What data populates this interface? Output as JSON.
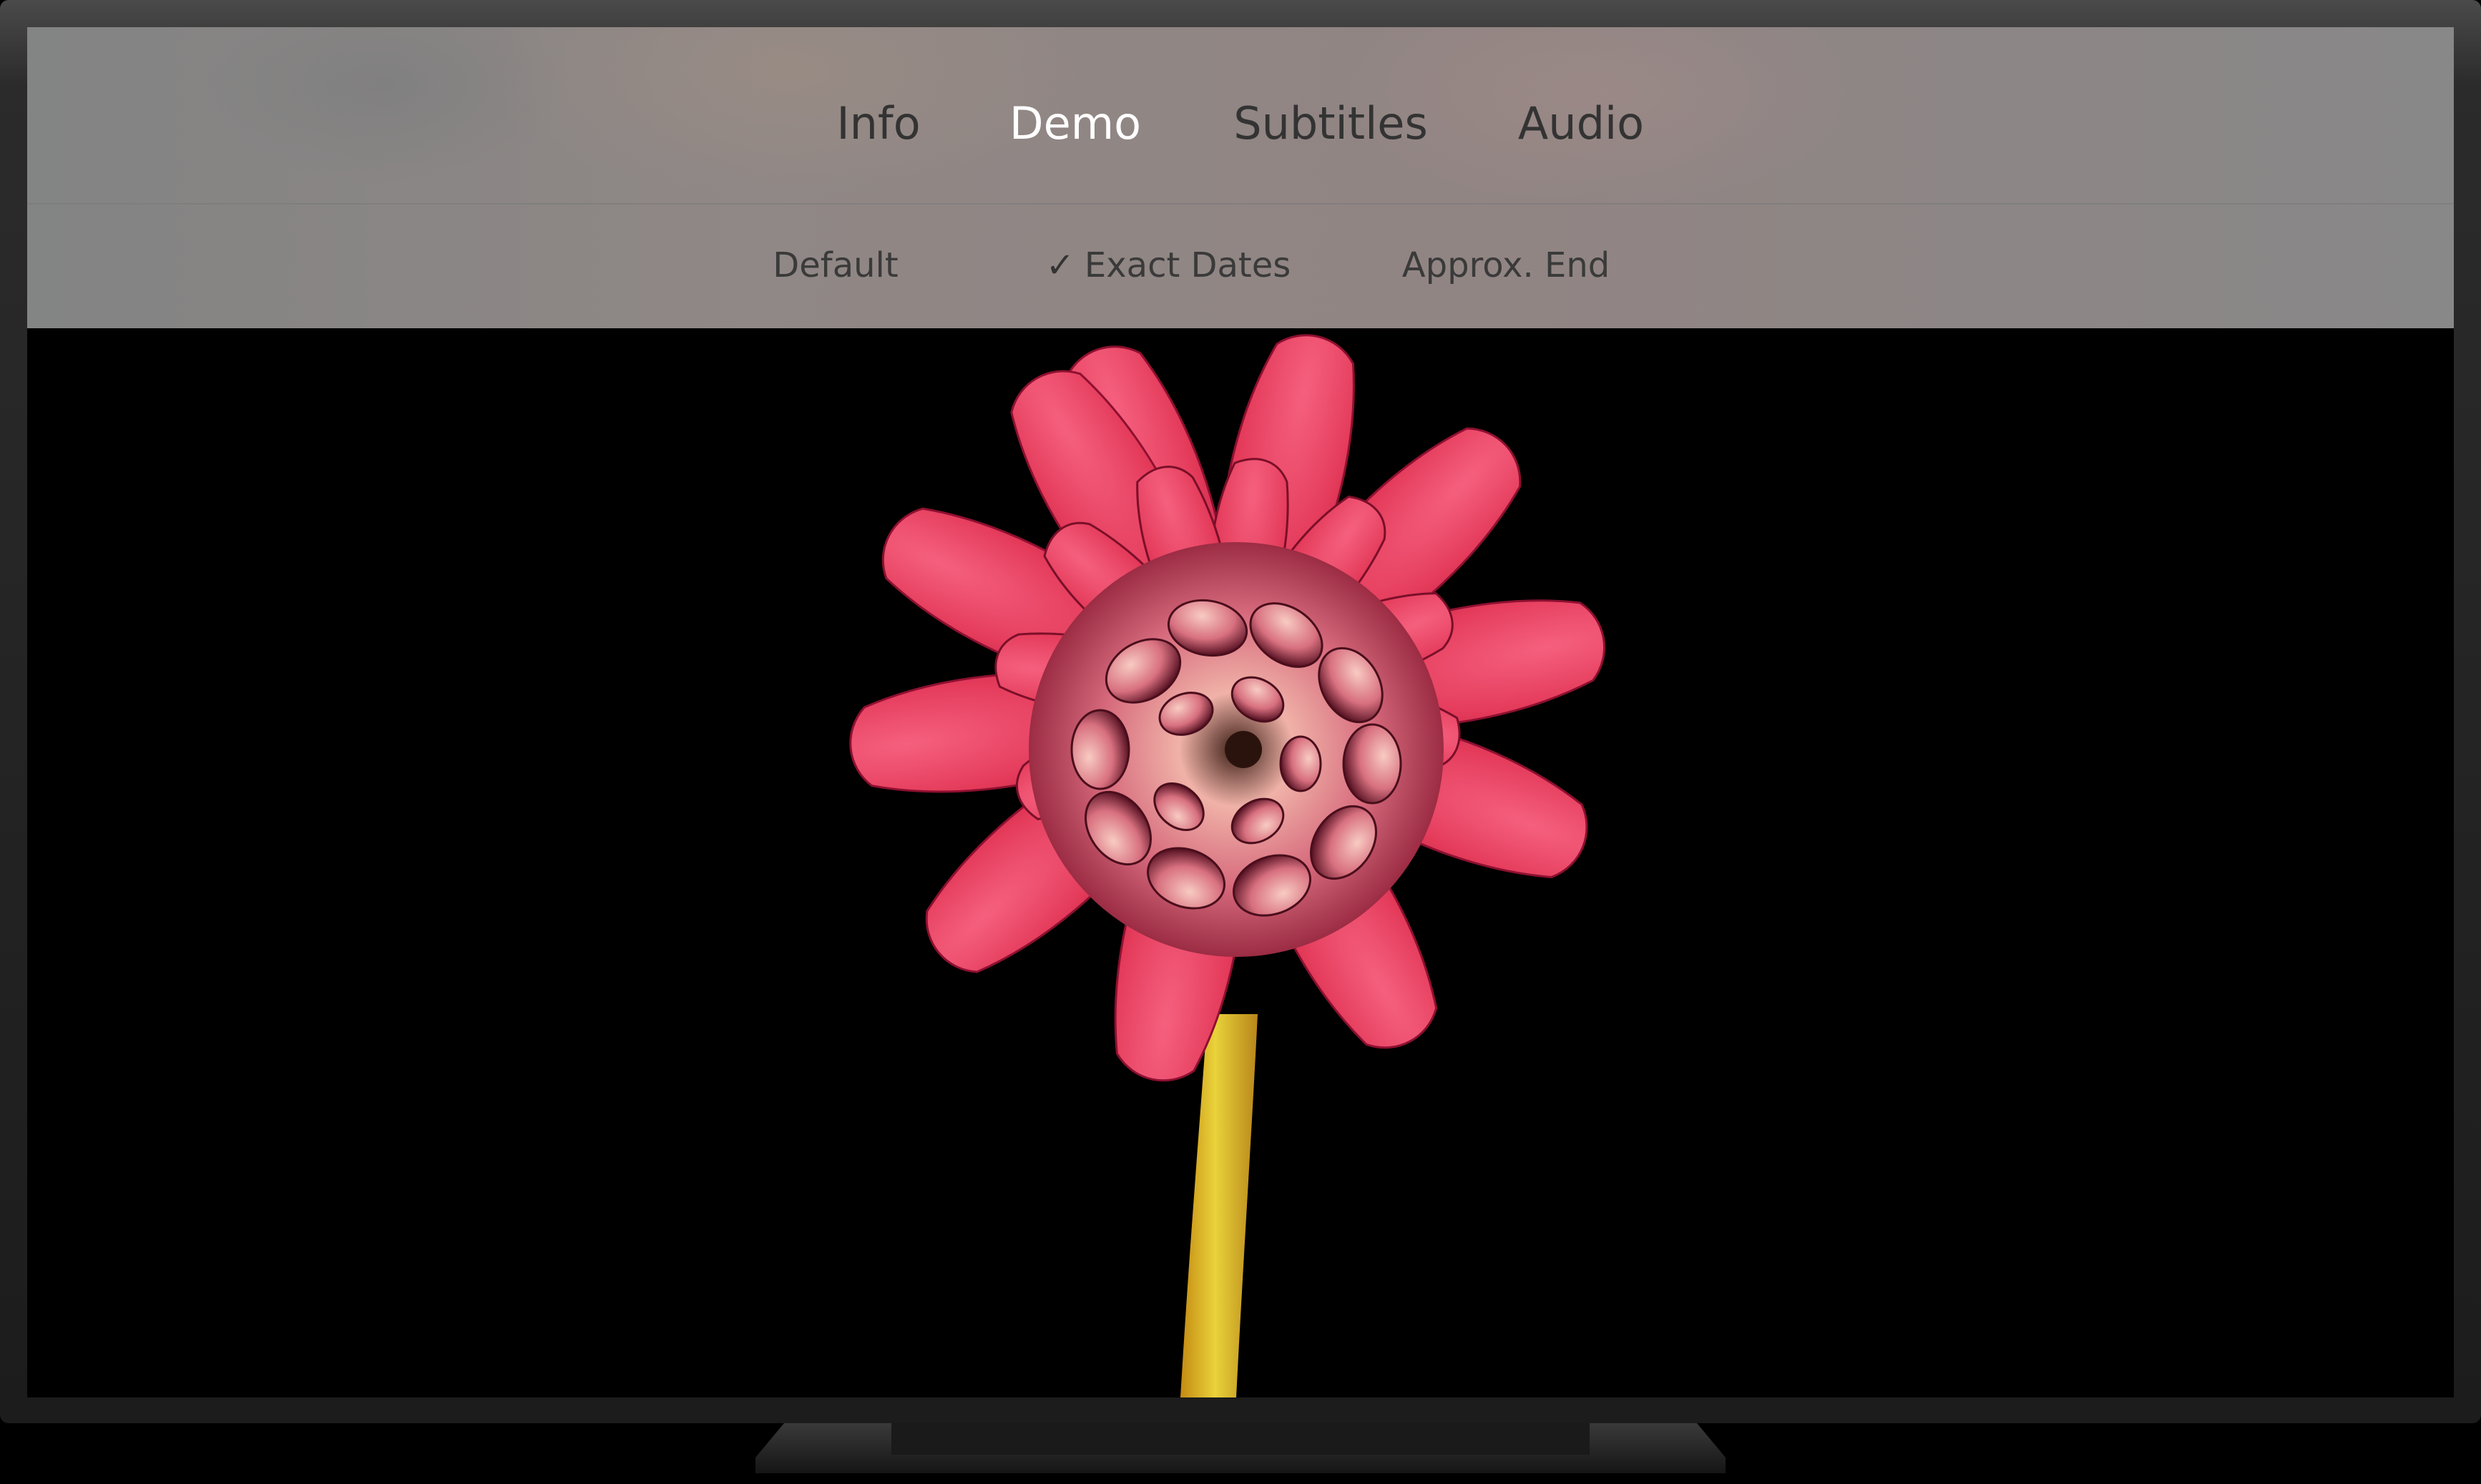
{
  "tabs": [
    {
      "label": "Info",
      "active": false
    },
    {
      "label": "Demo",
      "active": true
    },
    {
      "label": "Subtitles",
      "active": false
    },
    {
      "label": "Audio",
      "active": false
    }
  ],
  "options": [
    {
      "label": "Default",
      "checked": false
    },
    {
      "label": "Exact Dates",
      "checked": true
    },
    {
      "label": "Approx. End",
      "checked": false
    }
  ],
  "icons": {
    "check": "checkmark-icon"
  },
  "colors": {
    "active_tab": "#ffffff",
    "inactive_tab": "#333333",
    "video_background": "#000000",
    "petal": "#e83a5d",
    "stem": "#d8c22a"
  }
}
